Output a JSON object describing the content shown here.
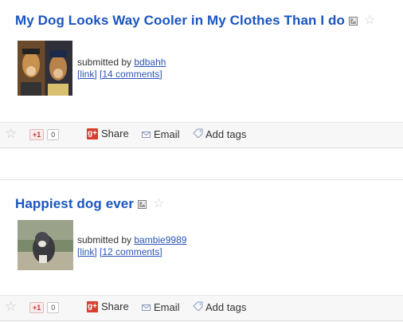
{
  "posts": [
    {
      "title": "My Dog Looks Way Cooler in My Clothes Than I do",
      "submitted_prefix": "submitted by ",
      "author": "bdbahh",
      "link_label": "[link]",
      "comments_label": "[14 comments]",
      "actions": {
        "plusone_badge": "+1",
        "plusone_count": "0",
        "share_label": "Share",
        "email_label": "Email",
        "tags_label": "Add tags"
      }
    },
    {
      "title": "Happiest dog ever",
      "submitted_prefix": "submitted by ",
      "author": "bambie9989",
      "link_label": "[link]",
      "comments_label": "[12 comments]",
      "actions": {
        "plusone_badge": "+1",
        "plusone_count": "0",
        "share_label": "Share",
        "email_label": "Email",
        "tags_label": "Add tags"
      }
    }
  ],
  "icons": {
    "external_link": "external-link-icon",
    "star": "star-icon",
    "google_plus": "google-plus-icon",
    "email": "envelope-icon",
    "tag": "tag-icon"
  },
  "colors": {
    "title": "#1a55c0",
    "link": "#2d55b7",
    "action_bar_bg": "#f7f7f7",
    "gplus_red": "#d73d32"
  }
}
